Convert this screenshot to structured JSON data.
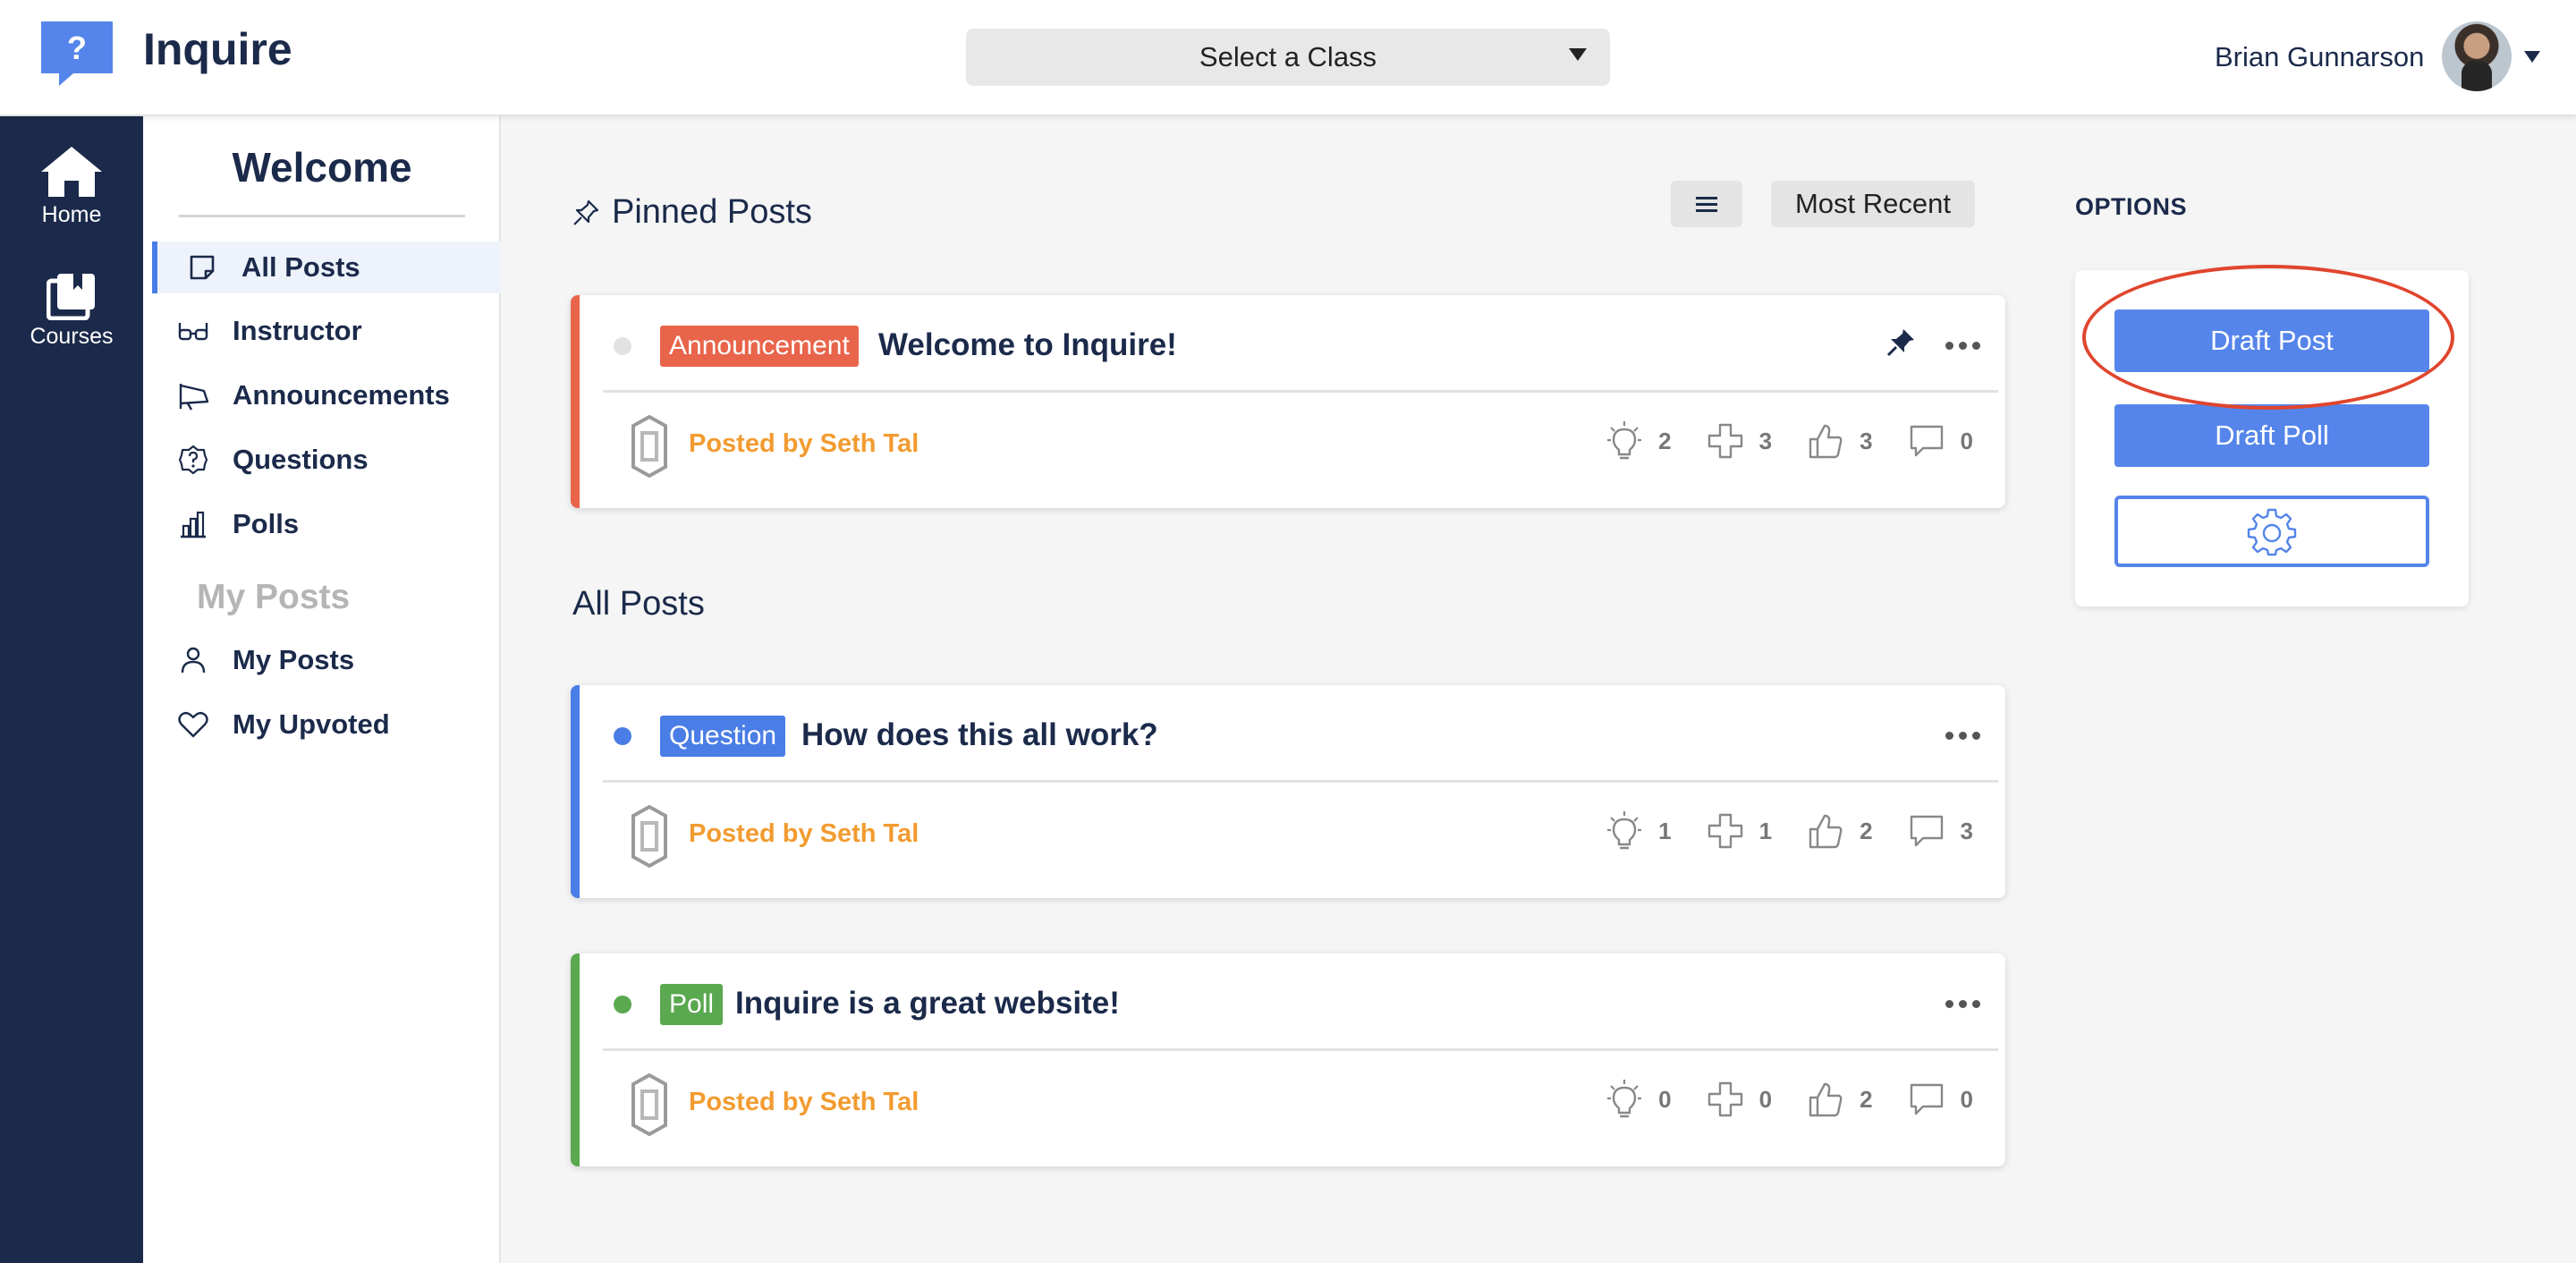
{
  "app": {
    "title": "Inquire",
    "logo_glyph": "?"
  },
  "header": {
    "class_select": "Select a Class",
    "user_name": "Brian Gunnarson"
  },
  "rail": {
    "items": [
      {
        "label": "Home",
        "icon": "home-icon"
      },
      {
        "label": "Courses",
        "icon": "courses-icon"
      }
    ]
  },
  "sidebar": {
    "welcome": "Welcome",
    "items": [
      {
        "label": "All Posts",
        "icon": "post-icon"
      },
      {
        "label": "Instructor",
        "icon": "glasses-icon"
      },
      {
        "label": "Announcements",
        "icon": "megaphone-icon"
      },
      {
        "label": "Questions",
        "icon": "question-icon"
      },
      {
        "label": "Polls",
        "icon": "poll-icon"
      }
    ],
    "my_posts_heading": "My Posts",
    "my_items": [
      {
        "label": "My Posts",
        "icon": "person-icon"
      },
      {
        "label": "My Upvoted",
        "icon": "heart-icon"
      }
    ]
  },
  "main": {
    "pinned_heading": "Pinned Posts",
    "sort_label": "Most Recent",
    "all_heading": "All Posts",
    "pinned": [
      {
        "badge": "Announcement",
        "title": "Welcome to Inquire!",
        "posted_by": "Posted by Seth Tal",
        "ideas": "2",
        "plus": "3",
        "likes": "3",
        "comments": "0"
      }
    ],
    "posts": [
      {
        "badge": "Question",
        "title": "How does this all work?",
        "posted_by": "Posted by Seth Tal",
        "ideas": "1",
        "plus": "1",
        "likes": "2",
        "comments": "3"
      },
      {
        "badge": "Poll",
        "title": "Inquire is a great website!",
        "posted_by": "Posted by Seth Tal",
        "ideas": "0",
        "plus": "0",
        "likes": "2",
        "comments": "0"
      }
    ]
  },
  "options": {
    "heading": "OPTIONS",
    "draft_post": "Draft Post",
    "draft_poll": "Draft Poll"
  },
  "colors": {
    "navy": "#1b2a4a",
    "accent_blue": "#5585ea",
    "announcement": "#e8644a",
    "question": "#4a7de5",
    "poll": "#5aa84f",
    "author_orange": "#f29b30",
    "highlight_red": "#e0452e"
  }
}
